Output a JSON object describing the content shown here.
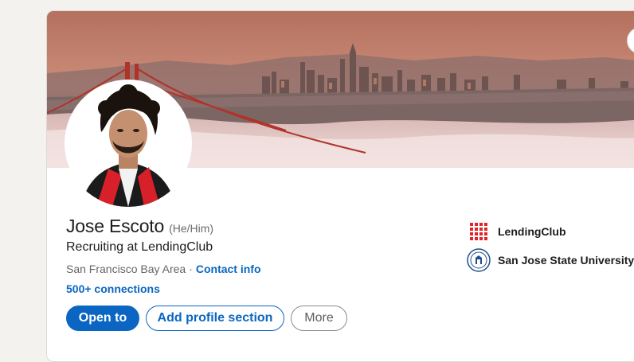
{
  "profile": {
    "name": "Jose Escoto",
    "pronouns": "(He/Him)",
    "headline": "Recruiting at LendingClub",
    "location": "San Francisco Bay Area",
    "separator": "·",
    "contact_info": "Contact info",
    "connections": "500+ connections"
  },
  "actions": {
    "open_to": "Open to",
    "add_section": "Add profile section",
    "more": "More"
  },
  "experience": {
    "company": "LendingClub",
    "company_icon": "lendingclub-logo-icon"
  },
  "education": {
    "school": "San Jose State University",
    "school_icon": "sjsu-seal-icon"
  },
  "colors": {
    "primary": "#0a66c2",
    "text": "#1d1d1d",
    "muted": "#666666",
    "lendingclub_red": "#e2232a"
  }
}
